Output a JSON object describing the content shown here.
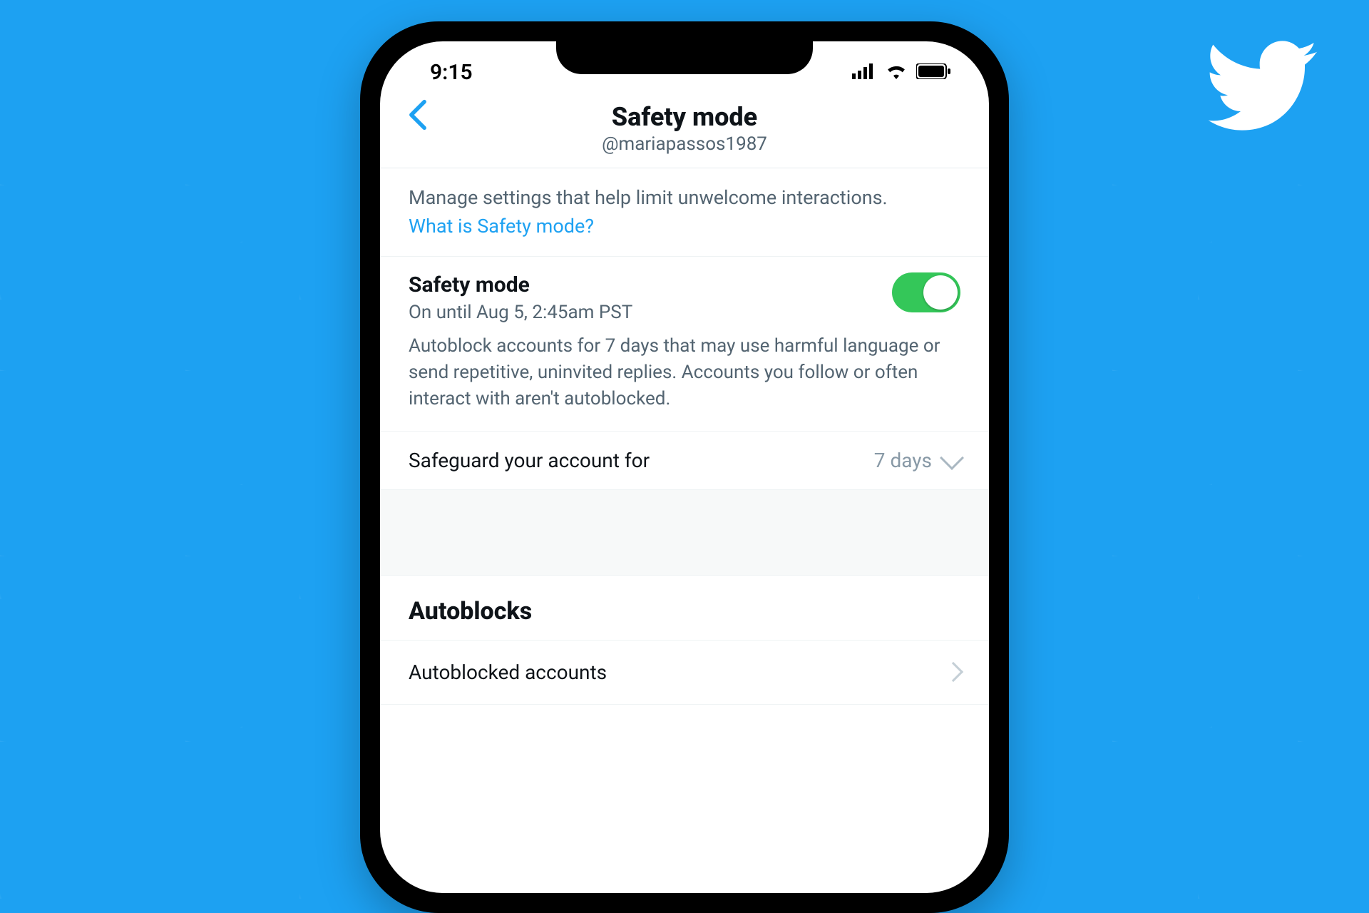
{
  "statusbar": {
    "time": "9:15"
  },
  "header": {
    "title": "Safety mode",
    "subtitle": "@mariapassos1987"
  },
  "intro": {
    "description": "Manage settings that help limit unwelcome interactions.",
    "link": "What is Safety mode?"
  },
  "safety_toggle": {
    "title": "Safety mode",
    "status": "On until Aug 5, 2:45am PST",
    "description": "Autoblock accounts for 7 days that may use harmful language or send repetitive, uninvited replies. Accounts you follow or often interact with aren't autoblocked.",
    "enabled": true
  },
  "duration": {
    "label": "Safeguard your account for",
    "value": "7 days"
  },
  "autoblocks": {
    "heading": "Autoblocks",
    "item": "Autoblocked accounts"
  },
  "colors": {
    "brand": "#1DA1F2",
    "toggle_on": "#34C759"
  }
}
